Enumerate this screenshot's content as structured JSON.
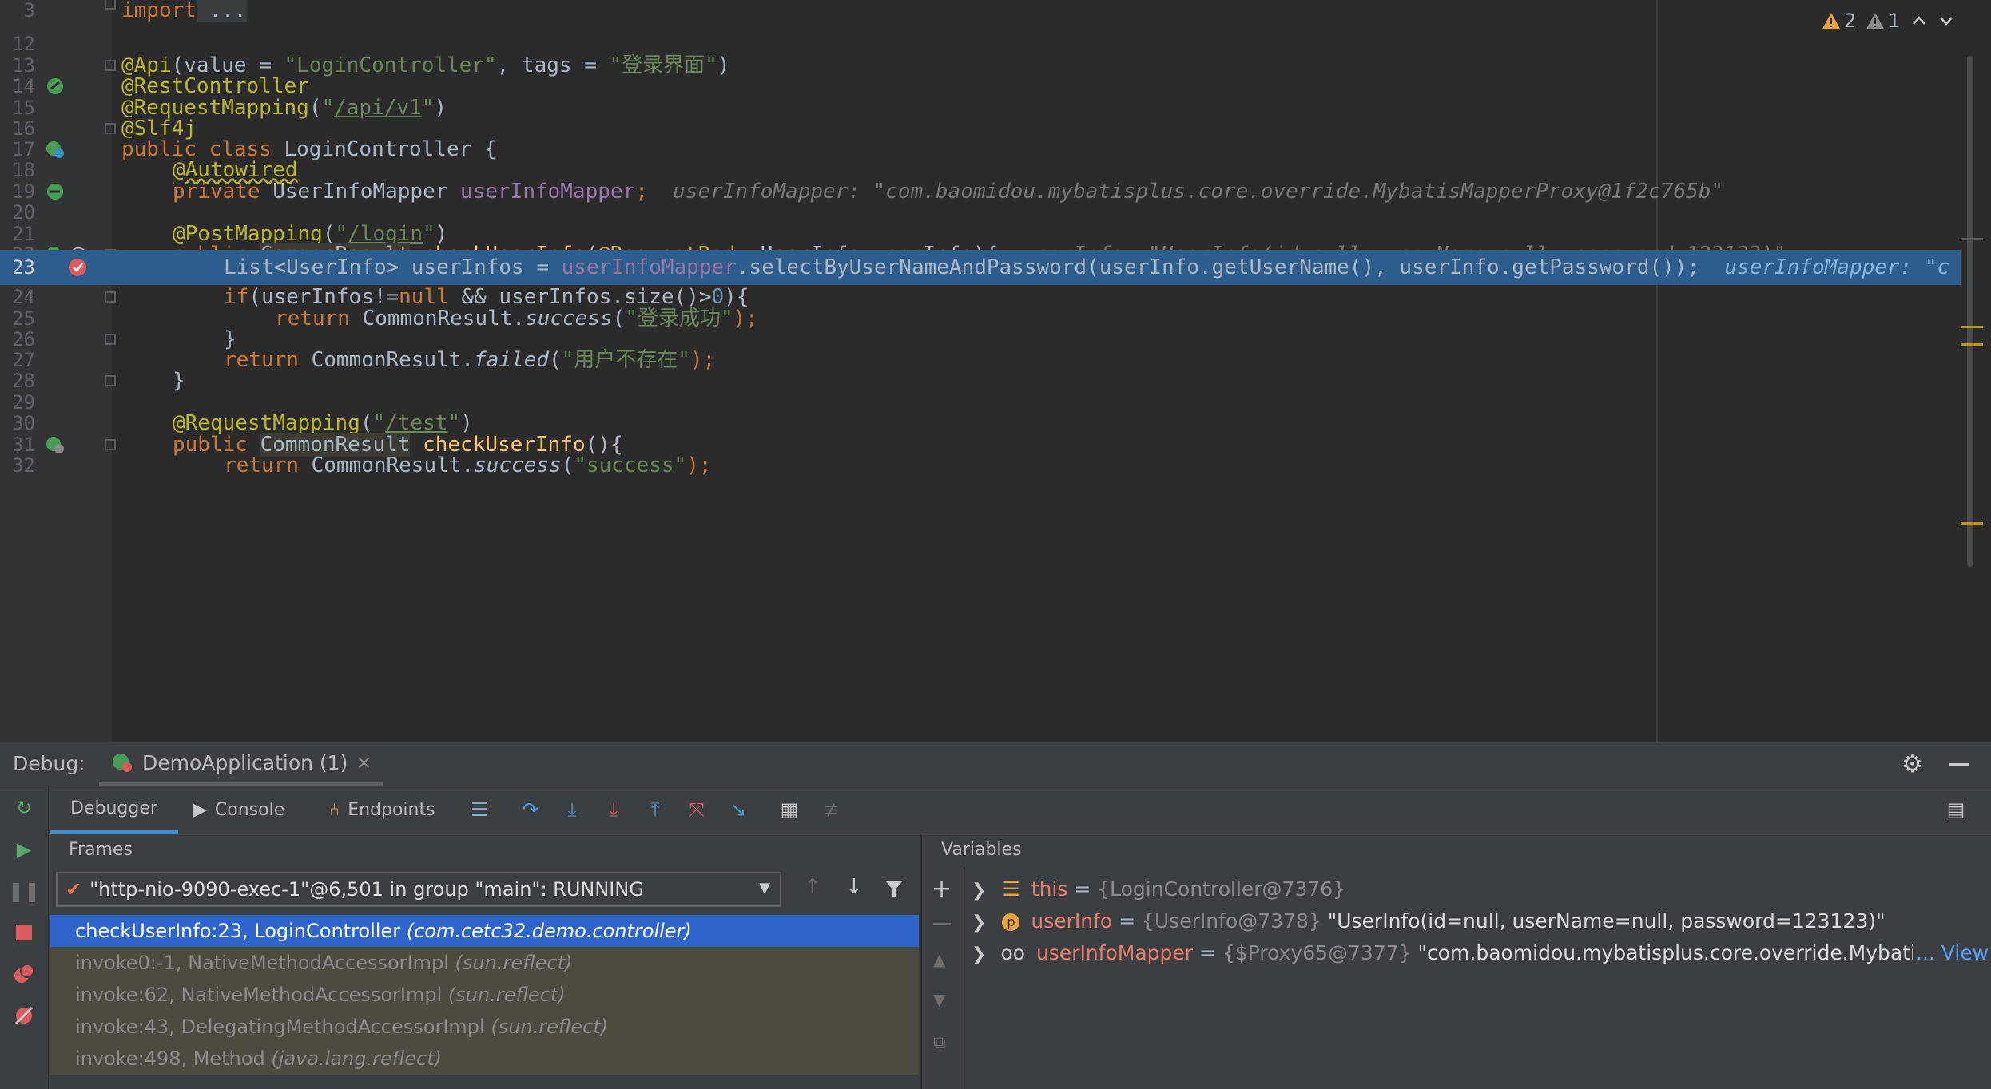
{
  "editor": {
    "warnings": {
      "warning_count": "2",
      "weak_count": "1"
    },
    "lines": [
      {
        "n": "3"
      },
      {
        "n": "12"
      },
      {
        "n": "13"
      },
      {
        "n": "14"
      },
      {
        "n": "15"
      },
      {
        "n": "16"
      },
      {
        "n": "17"
      },
      {
        "n": "18"
      },
      {
        "n": "19"
      },
      {
        "n": "20"
      },
      {
        "n": "21"
      },
      {
        "n": "22"
      },
      {
        "n": "23"
      },
      {
        "n": "24"
      },
      {
        "n": "25"
      },
      {
        "n": "26"
      },
      {
        "n": "27"
      },
      {
        "n": "28"
      },
      {
        "n": "29"
      },
      {
        "n": "30"
      },
      {
        "n": "31"
      },
      {
        "n": "32"
      }
    ],
    "code": {
      "l3_kw": "import",
      "l3_rest": " ...",
      "l13_a": "@Api",
      "l13_b": "(value = ",
      "l13_c": "\"LoginController\"",
      "l13_d": ", tags = ",
      "l13_e": "\"登录界面\"",
      "l13_f": ")",
      "l14": "@RestController",
      "l15_a": "@RequestMapping",
      "l15_b": "(",
      "l15_c": "\"",
      "l15_d": "/api/v1",
      "l15_e": "\"",
      "l15_f": ")",
      "l16": "@Slf4j",
      "l17_a": "public class ",
      "l17_b": "LoginController {",
      "l18": "@Autowired",
      "l19_a": "private ",
      "l19_b": "UserInfoMapper ",
      "l19_c": "userInfoMapper",
      "l19_d": ";",
      "l19_inline": "userInfoMapper: \"com.baomidou.mybatisplus.core.override.MybatisMapperProxy@1f2c765b\"",
      "l21_a": "@PostMapping",
      "l21_b": "(",
      "l21_c": "\"",
      "l21_d": "/login",
      "l21_e": "\"",
      "l21_f": ")",
      "l22_a": "public ",
      "l22_b": "CommonResult",
      "l22_c": " ",
      "l22_d": "checkUserInfo",
      "l22_e": "(",
      "l22_f": "@RequestBody",
      "l22_g": " UserInfo userInfo){",
      "l22_inline": "userInfo: \"UserInfo(id=null, userName=null, password=123123)\"",
      "l23_a": "List<UserInfo> userInfos = ",
      "l23_b": "userInfoMapper",
      "l23_c": ".selectByUserNameAndPassword(userInfo.getUserName(), userInfo.getPassword());",
      "l23_inline": "userInfoMapper: \"c",
      "l24_a": "if",
      "l24_b": "(userInfos!=",
      "l24_c": "null",
      "l24_d": " && userInfos.size()>",
      "l24_e": "0",
      "l24_f": "){",
      "l25_a": "return ",
      "l25_b": "CommonResult.",
      "l25_c": "success",
      "l25_d": "(",
      "l25_e": "\"登录成功\"",
      "l25_f": ");",
      "l26": "}",
      "l27_a": "return ",
      "l27_b": "CommonResult.",
      "l27_c": "failed",
      "l27_d": "(",
      "l27_e": "\"用户不存在\"",
      "l27_f": ");",
      "l28": "}",
      "l30_a": "@RequestMapping",
      "l30_b": "(",
      "l30_c": "\"",
      "l30_d": "/test",
      "l30_e": "\"",
      "l30_f": ")",
      "l31_a": "public ",
      "l31_b": "CommonResult",
      "l31_c": " ",
      "l31_d": "checkUserInfo",
      "l31_e": "(){",
      "l32_a": "return ",
      "l32_b": "CommonResult.",
      "l32_c": "success",
      "l32_d": "(",
      "l32_e": "\"success\"",
      "l32_f": ");"
    }
  },
  "debug": {
    "label": "Debug:",
    "session_tab": "DemoApplication (1)",
    "tabs": {
      "debugger": "Debugger",
      "console": "Console",
      "endpoints": "Endpoints"
    },
    "frames_title": "Frames",
    "variables_title": "Variables",
    "thread_select": "\"http-nio-9090-exec-1\"@6,501 in group \"main\": RUNNING",
    "frames": [
      {
        "method": "checkUserInfo:23, LoginController",
        "pkg": "(com.cetc32.demo.controller)"
      },
      {
        "method": "invoke0:-1, NativeMethodAccessorImpl",
        "pkg": "(sun.reflect)"
      },
      {
        "method": "invoke:62, NativeMethodAccessorImpl",
        "pkg": "(sun.reflect)"
      },
      {
        "method": "invoke:43, DelegatingMethodAccessorImpl",
        "pkg": "(sun.reflect)"
      },
      {
        "method": "invoke:498, Method",
        "pkg": "(java.lang.reflect)"
      }
    ],
    "variables": [
      {
        "name": "this",
        "eq": " = ",
        "type": "{LoginController@7376}",
        "value": ""
      },
      {
        "name": "userInfo",
        "eq": " = ",
        "type": "{UserInfo@7378}",
        "value": " \"UserInfo(id=null, userName=null, password=123123)\""
      },
      {
        "name": "userInfoMapper",
        "eq": " = ",
        "type": "{$Proxy65@7377}",
        "value": " \"com.baomidou.mybatisplus.core.override.Mybati:",
        "more": "... View"
      }
    ]
  },
  "colors": {
    "keyword": "#cc7832",
    "annotation": "#bbb529",
    "string": "#6a8759",
    "method": "#ffc66d",
    "field": "#9876aa",
    "selection": "#2d5d8c",
    "frame_selected": "#2f65ca"
  },
  "icons": [
    "warning-icon",
    "weak-warning-icon",
    "chevron-up-icon",
    "chevron-down-icon",
    "bean-icon",
    "breakpoint-icon",
    "rerun-icon",
    "resume-icon",
    "pause-icon",
    "stop-icon",
    "view-breakpoints-icon",
    "mute-breakpoints-icon",
    "step-over-icon",
    "step-into-icon",
    "force-step-into-icon",
    "step-out-icon",
    "drop-frame-icon",
    "run-to-cursor-icon",
    "evaluate-icon",
    "trace-icon",
    "settings-icon",
    "minimize-icon",
    "filter-icon",
    "add-watch-icon"
  ]
}
